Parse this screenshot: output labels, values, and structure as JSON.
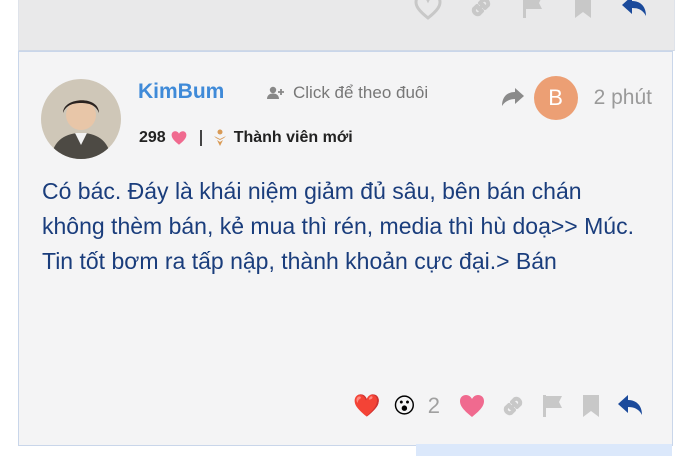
{
  "post": {
    "username": "KimBum",
    "follow_label": "Click để theo đuôi",
    "reply_avatar_letter": "B",
    "time": "2 phút",
    "likes_received": "298",
    "trust_level": "Thành viên mới",
    "body": "Có bác. Đáy là khái niệm giảm đủ sâu, bên bán chán không thèm bán, kẻ mua thì rén, media thì hù doạ>> Múc. Tin tốt bơm ra tấp nập, thành khoản cực đại.> Bán",
    "reactions": [
      "❤️",
      "😮"
    ],
    "reaction_count": "2"
  },
  "colors": {
    "username": "#3f8ad8",
    "body_text": "#1a3d7c",
    "heart": "#f06a8f",
    "reply_avatar": "#ec9f74",
    "reply_icon": "#1b4a9b",
    "muted_icon": "#c8c8c8"
  }
}
